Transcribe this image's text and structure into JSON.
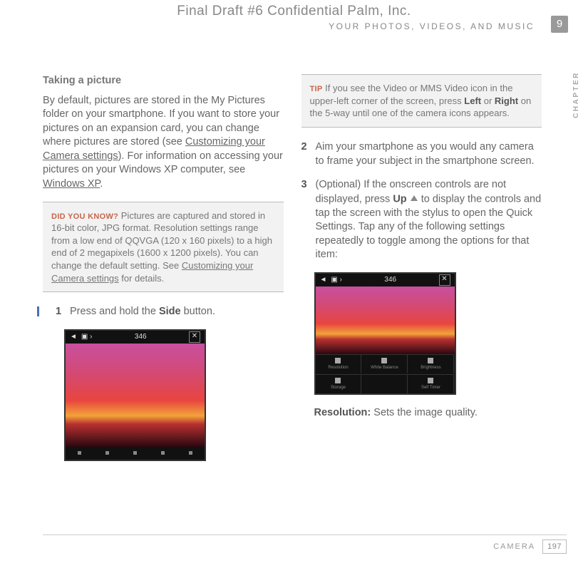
{
  "header": {
    "top": "Final Draft #6    Confidential    Palm, Inc.",
    "sub": "YOUR PHOTOS, VIDEOS, AND MUSIC",
    "chapter_number": "9",
    "chapter_label": "CHAPTER"
  },
  "left": {
    "title": "Taking a picture",
    "para1_a": "By default, pictures are stored in the My Pictures folder on your smartphone. If you want to store your pictures on an expansion card, you can change where pictures are stored (see ",
    "link1": "Customizing your Camera settings",
    "para1_b": "). For information on accessing your pictures on your Windows XP computer, see ",
    "link2": "Windows XP",
    "para1_c": ".",
    "dyk_label": "DID YOU KNOW?",
    "dyk_text_a": "Pictures are captured and stored in 16-bit color, JPG format. Resolution settings range from a low end of QQVGA (120 x 160 pixels) to a high end of 2 megapixels (1600 x 1200 pixels). You can change the default setting. See ",
    "dyk_link": "Customizing your Camera settings",
    "dyk_text_b": " for details.",
    "step1_num": "1",
    "step1_a": "Press and hold the ",
    "step1_bold": "Side",
    "step1_b": " button."
  },
  "right": {
    "tip_label": "TIP",
    "tip_a": "If you see the Video or MMS Video icon in the upper-left corner of the screen, press ",
    "tip_bold1": "Left",
    "tip_b": " or ",
    "tip_bold2": "Right",
    "tip_c": " on the 5-way until one of the camera icons appears.",
    "step2_num": "2",
    "step2_text": "Aim your smartphone as you would any camera to frame your subject in the smartphone screen.",
    "step3_num": "3",
    "step3_a": "(Optional) If the onscreen controls are not displayed, press ",
    "step3_bold": "Up",
    "step3_b": " to display the controls and tap the screen with the stylus to open the Quick Settings. Tap any of the following settings repeatedly to toggle among the options for that item:",
    "res_label": "Resolution:",
    "res_text": " Sets the image quality."
  },
  "shot": {
    "time": "346",
    "settings": [
      "Resolution",
      "White Balance",
      "Brightness",
      "Storage",
      "",
      "Self Timer"
    ]
  },
  "footer": {
    "section": "CAMERA",
    "page": "197"
  }
}
